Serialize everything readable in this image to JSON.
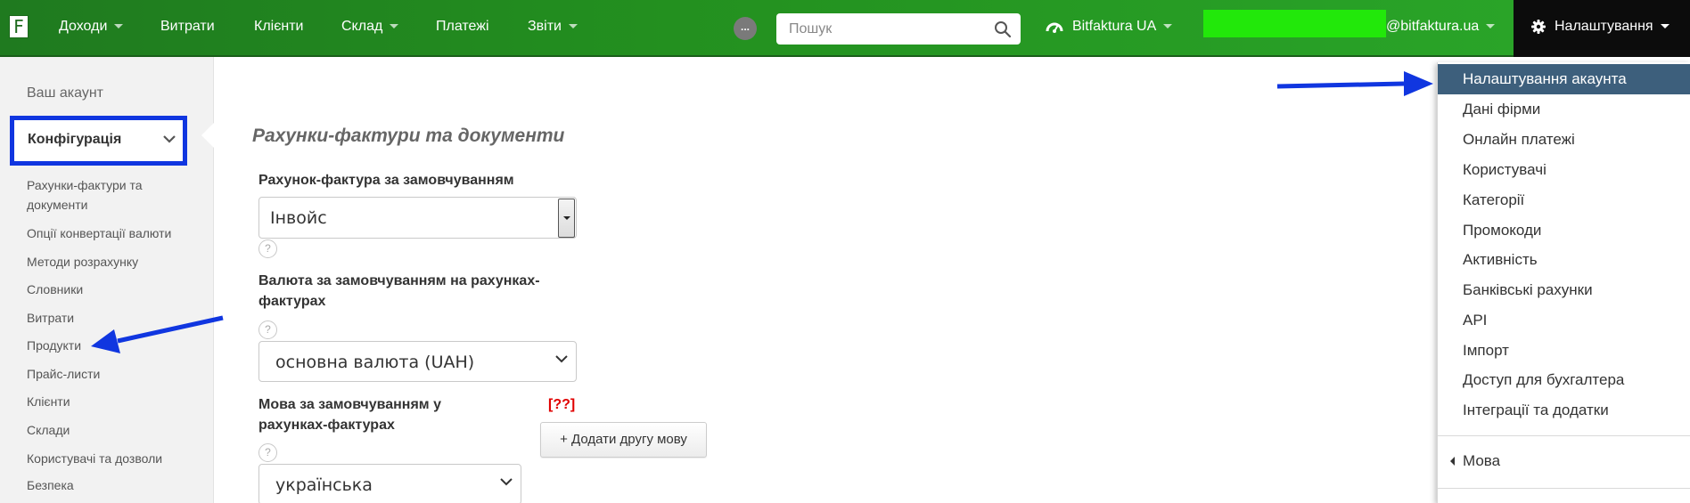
{
  "topbar": {
    "logo_letter": "F",
    "nav": [
      {
        "label": "Доходи"
      },
      {
        "label": "Витрати"
      },
      {
        "label": "Клієнти"
      },
      {
        "label": "Склад"
      },
      {
        "label": "Платежі"
      },
      {
        "label": "Звіти"
      }
    ],
    "more_label": "...",
    "search_placeholder": "Пошук",
    "company": "Bitfaktura UA",
    "email_suffix": "@bitfaktura.ua",
    "settings_label": "Налаштування"
  },
  "sidebar": {
    "account_label": "Ваш акаунт",
    "config_label": "Конфігурація",
    "items": [
      {
        "label": "Рахунки-фактури та документи"
      },
      {
        "label": "Опції конвертації валюти"
      },
      {
        "label": "Методи розрахунку"
      },
      {
        "label": "Словники"
      },
      {
        "label": "Витрати"
      },
      {
        "label": "Продукти"
      },
      {
        "label": "Прайс-листи"
      },
      {
        "label": "Клієнти"
      },
      {
        "label": "Склади"
      },
      {
        "label": "Користувачі та дозволи"
      },
      {
        "label": "Безпека"
      }
    ]
  },
  "main": {
    "title": "Рахунки-фактури та документи",
    "default_invoice_label": "Рахунок-фактура за замовчуванням",
    "default_invoice_value": "Інвойс",
    "help_glyph": "?",
    "default_currency_label": "Валюта за замовчуванням на рахунках-фактурах",
    "default_currency_value": "основна валюта (UAH)",
    "default_language_label": "Мова за замовчуванням у рахунках-фактурах",
    "default_language_value": "українська",
    "missing_marker": "[??]",
    "add_language_button": "+ Додати другу мову"
  },
  "settings_menu": {
    "items": [
      {
        "label": "Налаштування акаунта",
        "active": true
      },
      {
        "label": "Дані фірми"
      },
      {
        "label": "Онлайн платежі"
      },
      {
        "label": "Користувачі"
      },
      {
        "label": "Категорії"
      },
      {
        "label": "Промокоди"
      },
      {
        "label": "Активність"
      },
      {
        "label": "Банківські рахунки"
      },
      {
        "label": "API"
      },
      {
        "label": "Імпорт"
      },
      {
        "label": "Доступ для бухгалтера"
      },
      {
        "label": "Інтеграції та додатки"
      }
    ],
    "language_label": "Мова"
  },
  "colors": {
    "topbar_green": "#2ba82a",
    "highlight_blue": "#1036e0",
    "active_menu": "#3d5f7c",
    "redaction_green": "#22e80a"
  },
  "icons": [
    "logo-icon",
    "search-icon",
    "dashboard-icon",
    "gear-icon",
    "chevron-down-icon",
    "help-icon",
    "caret-left-icon",
    "arrow-annotation-icon"
  ]
}
